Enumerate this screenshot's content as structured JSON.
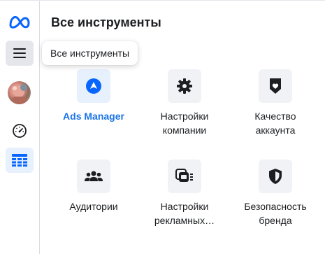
{
  "header": {
    "title": "Все инструменты"
  },
  "tooltip": {
    "text": "Все инструменты"
  },
  "rail": {
    "logo_icon": "meta-logo-icon",
    "items": [
      {
        "icon": "menu-icon"
      },
      {
        "icon": "avatar"
      },
      {
        "icon": "gauge-icon"
      },
      {
        "icon": "table-grid-icon",
        "active": true
      }
    ]
  },
  "tools": [
    {
      "label": "Ads Manager",
      "icon": "navigation-arrow-icon",
      "highlighted": true
    },
    {
      "label": "Настройки компании",
      "icon": "gear-icon"
    },
    {
      "label": "Качество аккаунта",
      "icon": "shield-heart-icon"
    },
    {
      "label": "Аудитории",
      "icon": "people-icon"
    },
    {
      "label": "Настройки рекламных…",
      "icon": "ad-settings-icon"
    },
    {
      "label": "Безопасность бренда",
      "icon": "shield-icon"
    }
  ],
  "colors": {
    "accent": "#1a73e8",
    "rail_active": "#e7f0fd",
    "tile": "#f0f2f5"
  }
}
